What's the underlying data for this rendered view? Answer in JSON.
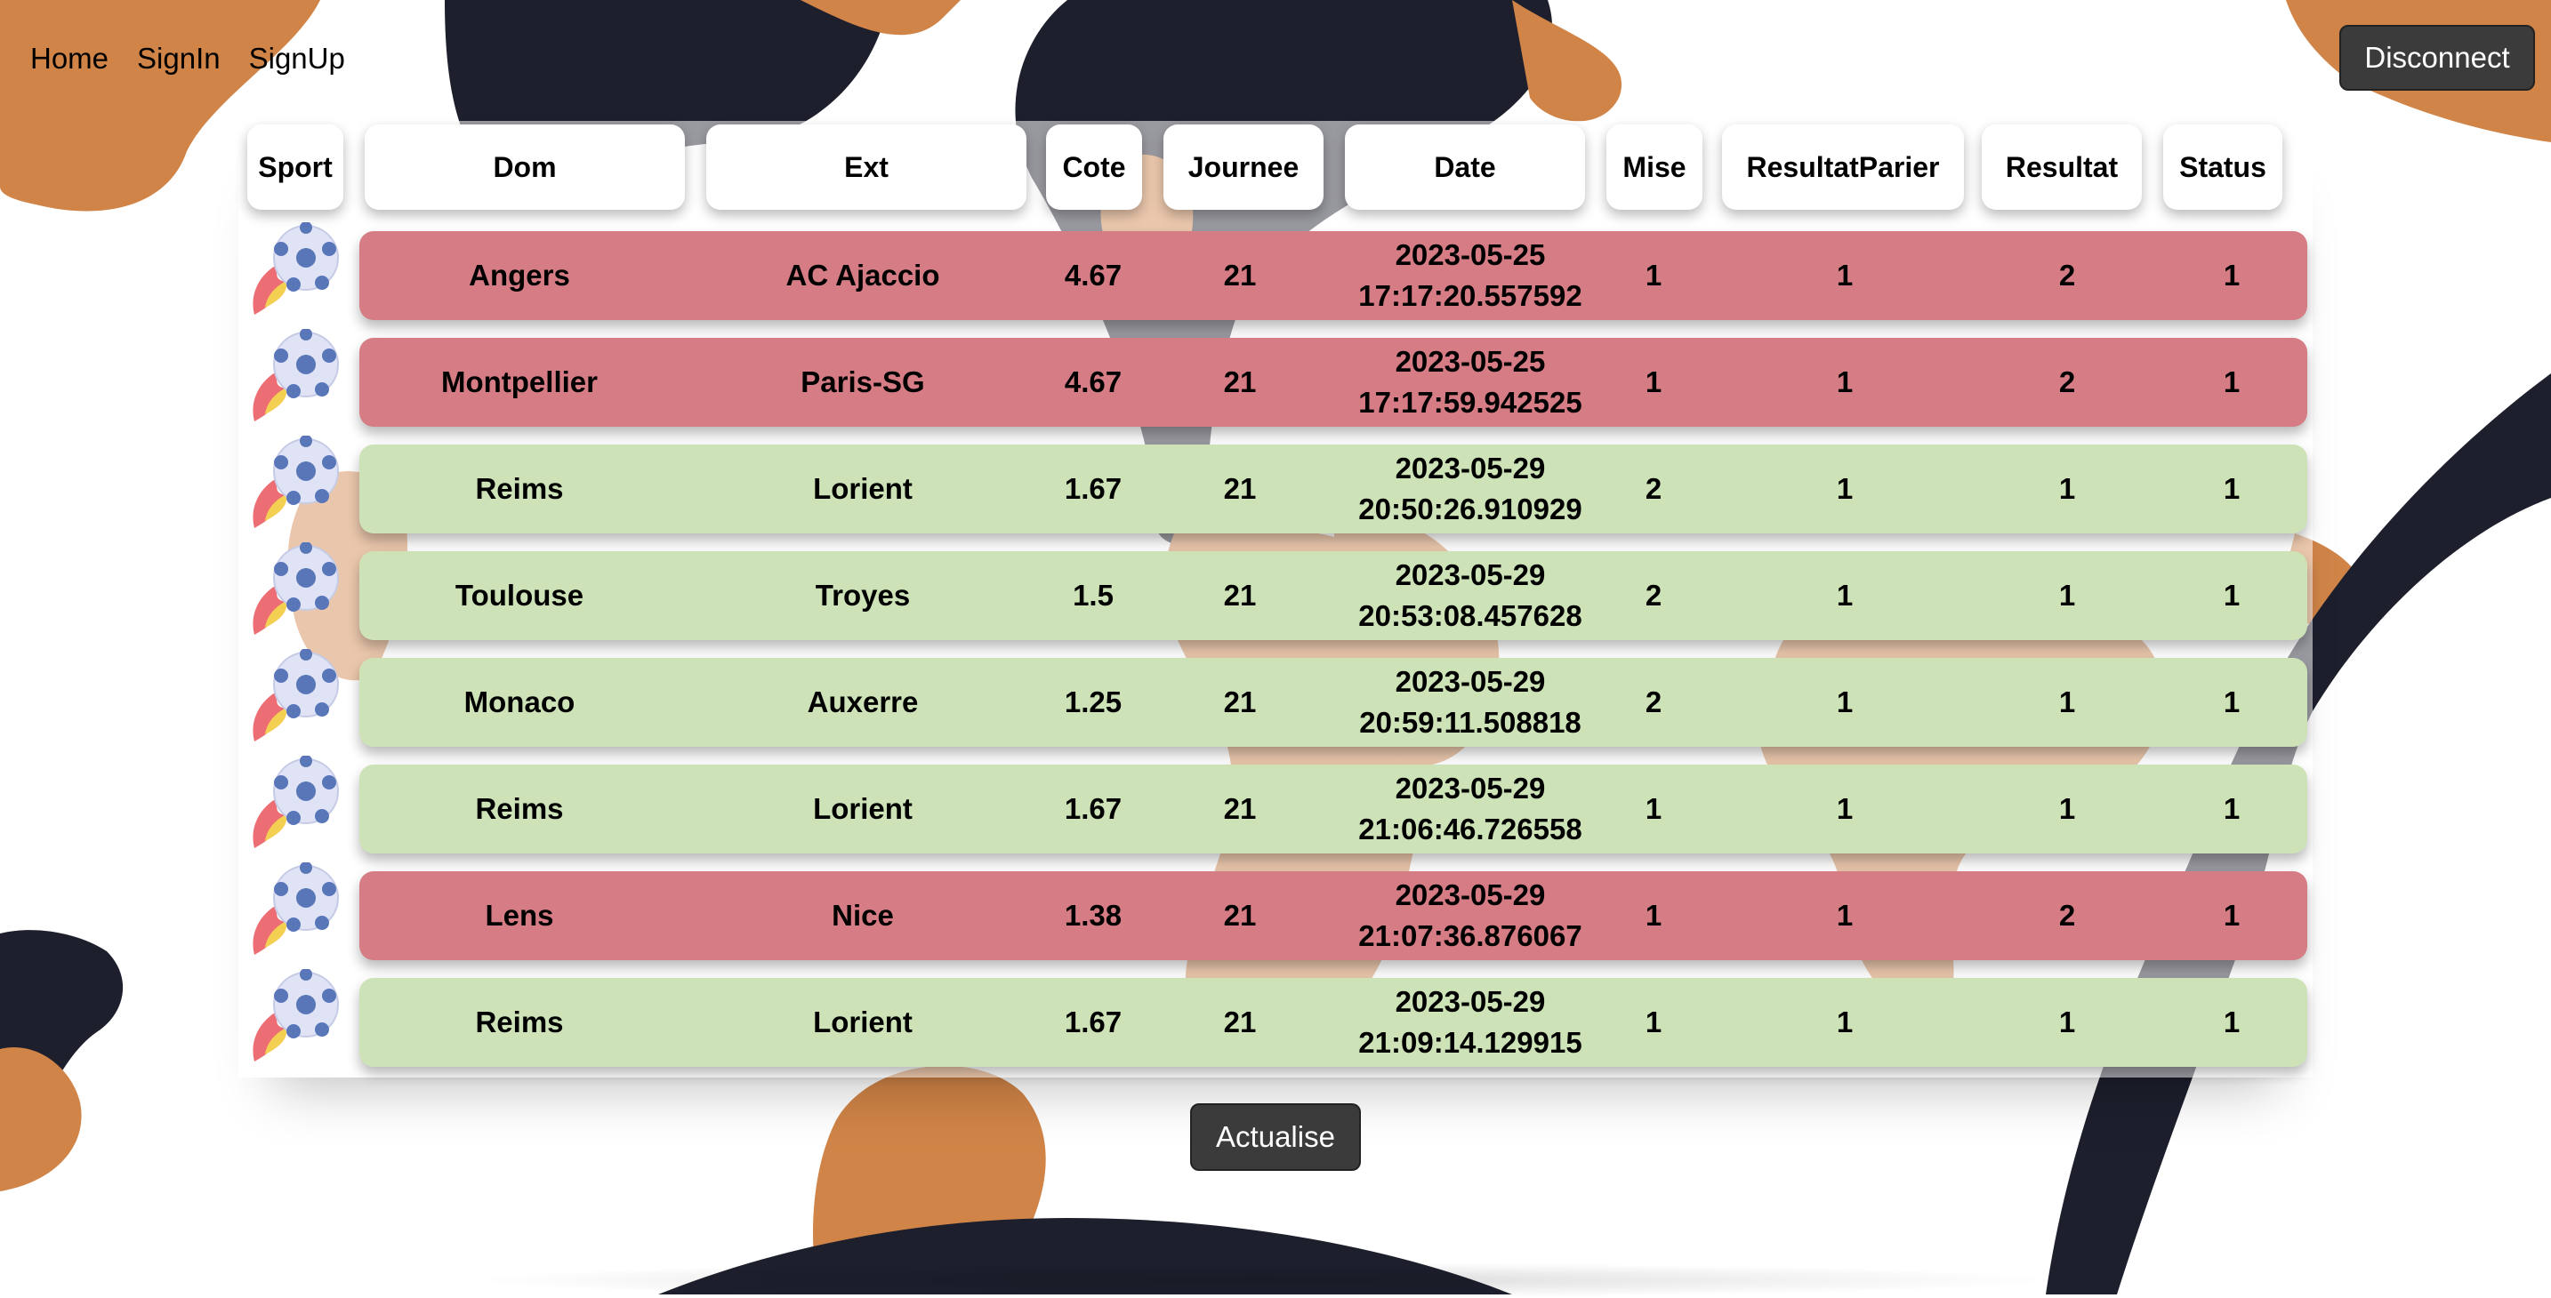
{
  "nav": {
    "home": "Home",
    "signin": "SignIn",
    "signup": "SignUp"
  },
  "header_actions": {
    "disconnect_label": "Disconnect"
  },
  "table": {
    "headers": [
      "Sport",
      "Dom",
      "Ext",
      "Cote",
      "Journee",
      "Date",
      "Mise",
      "ResultatParier",
      "Resultat",
      "Status"
    ],
    "rows": [
      {
        "dom": "Angers",
        "ext": "AC Ajaccio",
        "cote": "4.67",
        "journee": "21",
        "date": "2023-05-25",
        "time": "17:17:20.557592",
        "mise": "1",
        "resultat_parier": "1",
        "resultat": "2",
        "status": "1",
        "outcome": "loss"
      },
      {
        "dom": "Montpellier",
        "ext": "Paris-SG",
        "cote": "4.67",
        "journee": "21",
        "date": "2023-05-25",
        "time": "17:17:59.942525",
        "mise": "1",
        "resultat_parier": "1",
        "resultat": "2",
        "status": "1",
        "outcome": "loss"
      },
      {
        "dom": "Reims",
        "ext": "Lorient",
        "cote": "1.67",
        "journee": "21",
        "date": "2023-05-29",
        "time": "20:50:26.910929",
        "mise": "2",
        "resultat_parier": "1",
        "resultat": "1",
        "status": "1",
        "outcome": "win"
      },
      {
        "dom": "Toulouse",
        "ext": "Troyes",
        "cote": "1.5",
        "journee": "21",
        "date": "2023-05-29",
        "time": "20:53:08.457628",
        "mise": "2",
        "resultat_parier": "1",
        "resultat": "1",
        "status": "1",
        "outcome": "win"
      },
      {
        "dom": "Monaco",
        "ext": "Auxerre",
        "cote": "1.25",
        "journee": "21",
        "date": "2023-05-29",
        "time": "20:59:11.508818",
        "mise": "2",
        "resultat_parier": "1",
        "resultat": "1",
        "status": "1",
        "outcome": "win"
      },
      {
        "dom": "Reims",
        "ext": "Lorient",
        "cote": "1.67",
        "journee": "21",
        "date": "2023-05-29",
        "time": "21:06:46.726558",
        "mise": "1",
        "resultat_parier": "1",
        "resultat": "1",
        "status": "1",
        "outcome": "win"
      },
      {
        "dom": "Lens",
        "ext": "Nice",
        "cote": "1.38",
        "journee": "21",
        "date": "2023-05-29",
        "time": "21:07:36.876067",
        "mise": "1",
        "resultat_parier": "1",
        "resultat": "2",
        "status": "1",
        "outcome": "loss"
      },
      {
        "dom": "Reims",
        "ext": "Lorient",
        "cote": "1.67",
        "journee": "21",
        "date": "2023-05-29",
        "time": "21:09:14.129915",
        "mise": "1",
        "resultat_parier": "1",
        "resultat": "1",
        "status": "1",
        "outcome": "win"
      }
    ],
    "sport_icon": "soccer-ball-flame-icon"
  },
  "footer": {
    "actualise_label": "Actualise"
  },
  "colors": {
    "loss_row": "#d67c84",
    "win_row": "#cde3b7",
    "button_bg": "#3b3b3b",
    "blob_dark": "#1d1f2d",
    "blob_orange": "#d08447"
  }
}
